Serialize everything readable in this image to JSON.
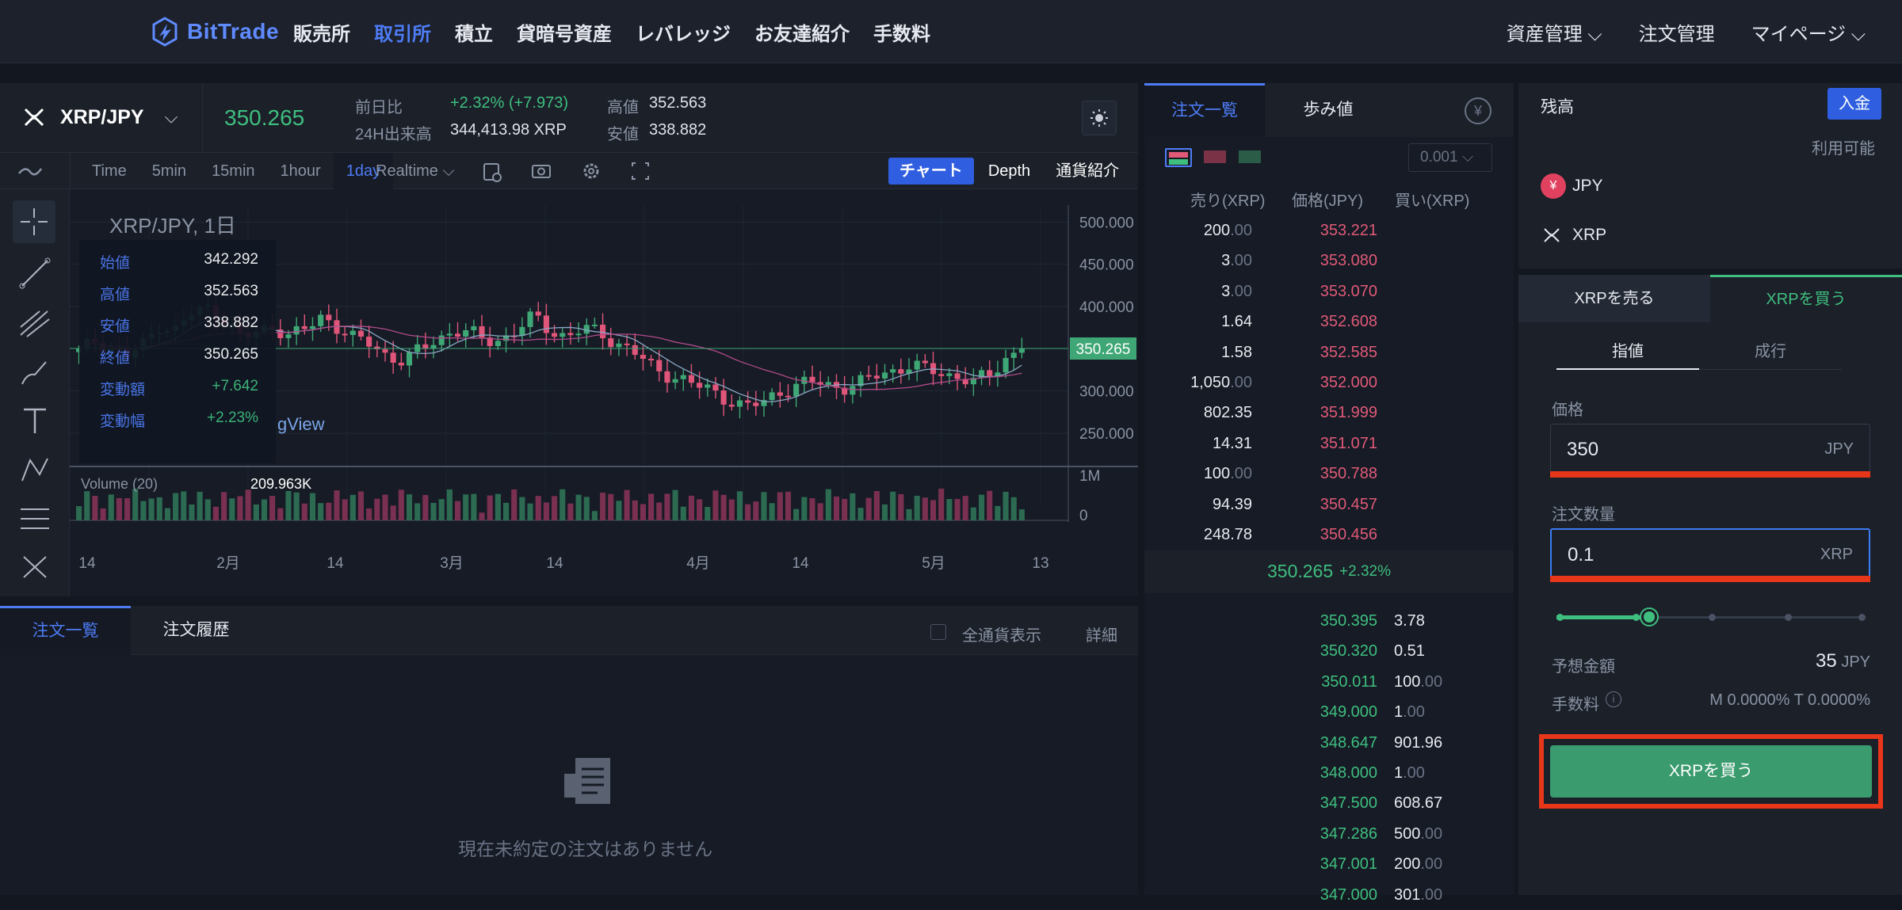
{
  "nav": {
    "logo": "BitTrade",
    "links": [
      "販売所",
      "取引所",
      "積立",
      "貸暗号資産",
      "レバレッジ",
      "お友達紹介",
      "手数料"
    ],
    "active": "取引所",
    "right": [
      "資産管理",
      "注文管理",
      "マイページ"
    ]
  },
  "ticker": {
    "pair": "XRP/JPY",
    "last": "350.265",
    "change_label": "前日比",
    "change": "+2.32% (+7.973)",
    "volume_label": "24H出来高",
    "volume": "344,413.98 XRP",
    "high_label": "高値",
    "high": "352.563",
    "low_label": "安値",
    "low": "338.882"
  },
  "chart_toolbar": {
    "intervals": [
      "Time",
      "5min",
      "15min",
      "1hour",
      "1day"
    ],
    "active_interval": "1day",
    "realtime": "Realtime",
    "views": [
      "チャート",
      "Depth",
      "通貨紹介"
    ],
    "active_view": "チャート"
  },
  "chart_info": {
    "title": "XRP/JPY, 1日",
    "rows": [
      {
        "label": "始値",
        "value": "342.292"
      },
      {
        "label": "高値",
        "value": "352.563"
      },
      {
        "label": "安値",
        "value": "338.882"
      },
      {
        "label": "終値",
        "value": "350.265"
      },
      {
        "label": "変動額",
        "value": "+7.642"
      },
      {
        "label": "変動幅",
        "value": "+2.23%"
      }
    ],
    "watermark": "gView",
    "volume_label": "Volume (20)",
    "volume_value": "209.963K",
    "price_tag": "350.265"
  },
  "chart_data": {
    "type": "candlestick",
    "title": "XRP/JPY, 1日",
    "yticks": [
      "500.000",
      "450.000",
      "400.000",
      "350.000",
      "300.000",
      "250.000"
    ],
    "ylim": [
      220,
      520
    ],
    "vol_ticks": [
      "1M",
      "0"
    ],
    "xticks": [
      "14",
      "2月",
      "14",
      "3月",
      "14",
      "4月",
      "14",
      "5月",
      "13"
    ],
    "last_price": 350.265,
    "close_path": [
      345,
      360,
      352,
      340,
      355,
      380,
      372,
      392,
      398,
      385,
      360,
      370,
      378,
      365,
      372,
      390,
      375,
      360,
      355,
      342,
      335,
      348,
      362,
      372,
      368,
      360,
      362,
      372,
      388,
      372,
      365,
      372,
      370,
      358,
      348,
      330,
      322,
      315,
      305,
      300,
      290,
      280,
      285,
      300,
      305,
      310,
      308,
      305,
      308,
      318,
      325,
      330,
      325,
      322,
      318,
      310,
      318,
      340,
      350
    ],
    "colors": {
      "up": "#3fa776",
      "down": "#e0557a"
    }
  },
  "orders_panel": {
    "tabs": [
      "注文一覧",
      "注文履歴"
    ],
    "active_tab": "注文一覧",
    "all_label": "全通貨表示",
    "detail": "詳細",
    "empty": "現在未約定の注文はありません"
  },
  "orderbook": {
    "tabs": [
      "注文一覧",
      "歩み値"
    ],
    "active_tab": "注文一覧",
    "step": "0.001",
    "headers": [
      "売り(XRP)",
      "価格(JPY)",
      "買い(XRP)"
    ],
    "asks": [
      {
        "amount": "200",
        "dec": ".00",
        "price": "353.221"
      },
      {
        "amount": "3",
        "dec": ".00",
        "price": "353.080"
      },
      {
        "amount": "3",
        "dec": ".00",
        "price": "353.070"
      },
      {
        "amount": "1.64",
        "dec": "",
        "price": "352.608"
      },
      {
        "amount": "1.58",
        "dec": "",
        "price": "352.585"
      },
      {
        "amount": "1,050",
        "dec": ".00",
        "price": "352.000"
      },
      {
        "amount": "802.35",
        "dec": "",
        "price": "351.999"
      },
      {
        "amount": "14.31",
        "dec": "",
        "price": "351.071"
      },
      {
        "amount": "100",
        "dec": ".00",
        "price": "350.788"
      },
      {
        "amount": "94.39",
        "dec": "",
        "price": "350.457"
      },
      {
        "amount": "248.78",
        "dec": "",
        "price": "350.456"
      }
    ],
    "mid_price": "350.265",
    "mid_change": "+2.32%",
    "bids": [
      {
        "price": "350.395",
        "amount": "3.78",
        "dec": ""
      },
      {
        "price": "350.320",
        "amount": "0.51",
        "dec": ""
      },
      {
        "price": "350.011",
        "amount": "100",
        "dec": ".00"
      },
      {
        "price": "349.000",
        "amount": "1",
        "dec": ".00"
      },
      {
        "price": "348.647",
        "amount": "901.96",
        "dec": ""
      },
      {
        "price": "348.000",
        "amount": "1",
        "dec": ".00"
      },
      {
        "price": "347.500",
        "amount": "608.67",
        "dec": ""
      },
      {
        "price": "347.286",
        "amount": "500",
        "dec": ".00"
      },
      {
        "price": "347.001",
        "amount": "200",
        "dec": ".00"
      },
      {
        "price": "347.000",
        "amount": "301",
        "dec": ".00"
      }
    ]
  },
  "trade": {
    "balance": "残高",
    "deposit": "入金",
    "available": "利用可能",
    "assets": [
      "JPY",
      "XRP"
    ],
    "sell_tab": "XRPを売る",
    "buy_tab": "XRPを買う",
    "order_types": [
      "指値",
      "成行"
    ],
    "active_type": "指値",
    "price_label": "価格",
    "price_value": "350",
    "price_unit": "JPY",
    "qty_label": "注文数量",
    "qty_value": "0.1",
    "qty_unit": "XRP",
    "slider_level": 0.3,
    "est_label": "予想金額",
    "est_value": "35",
    "est_unit": "JPY",
    "fee_label": "手数料",
    "fee_value": "M 0.0000% T 0.0000%",
    "submit": "XRPを買う"
  }
}
